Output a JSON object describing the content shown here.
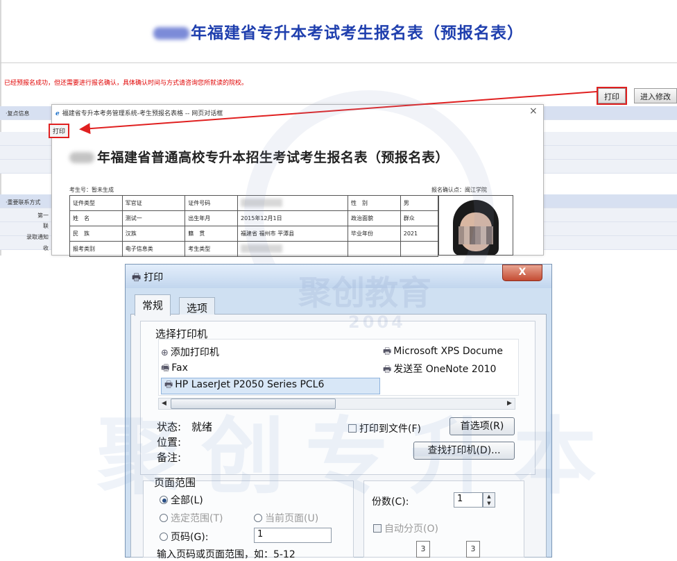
{
  "page": {
    "title_suffix": "年福建省专升本考试考生报名表（预报名表）",
    "notice": "已经预报名成功，但还需要进行报名确认，具体确认时间与方式请咨询您所就读的院校。",
    "buttons": {
      "print": "打印",
      "modify": "进入修改"
    },
    "section_labels": [
      "·复点信息",
      "·重要联系方式"
    ],
    "side_labels": [
      "第一",
      "联",
      "录取通知",
      "收"
    ]
  },
  "popup": {
    "window_title": "福建省专升本考务管理系统-考生预报名表格 -- 网页对话框",
    "close": "×",
    "print_button": "打印",
    "doc_title_suffix": "年福建省普通高校专升本招生考试考生报名表（预报名表）",
    "exam_no": "考生号：暂未生成",
    "confirm_point": "报名确认点：闽江学院",
    "table": [
      [
        "证件类型",
        "军官证",
        "证件号码",
        "",
        "性　别",
        "男"
      ],
      [
        "姓　名",
        "测试一",
        "出生年月",
        "2015年12月1日",
        "政治面貌",
        "群众"
      ],
      [
        "民　族",
        "汉族",
        "籍　贯",
        "福建省 福州市 平潭县",
        "毕业年份",
        "2021"
      ],
      [
        "报考类别",
        "电子信息类",
        "考生类型",
        "",
        "",
        ""
      ]
    ]
  },
  "watermark": {
    "brand": "聚创教育",
    "year": "2004",
    "big": "聚创专升本"
  },
  "dialog": {
    "title": "打印",
    "close": "X",
    "tabs": [
      "常规",
      "选项"
    ],
    "select_printer": "选择打印机",
    "printers": [
      "添加打印机",
      "Fax",
      "HP LaserJet P2050 Series PCL6",
      "Microsoft XPS Docume",
      "发送至 OneNote 2010"
    ],
    "status_label": "状态:",
    "status_value": "就绪",
    "location_label": "位置:",
    "comment_label": "备注:",
    "print_to_file": "打印到文件(F)",
    "preferences": "首选项(R)",
    "find_printer": "查找打印机(D)...",
    "page_range": "页面范围",
    "all": "全部(L)",
    "selection": "选定范围(T)",
    "current_page": "当前页面(U)",
    "pages": "页码(G):",
    "pages_value": "1",
    "hint": "输入页码或页面范围，如：5-12",
    "copies_label": "份数(C):",
    "copies_value": "1",
    "collate": "自动分页(O)"
  }
}
